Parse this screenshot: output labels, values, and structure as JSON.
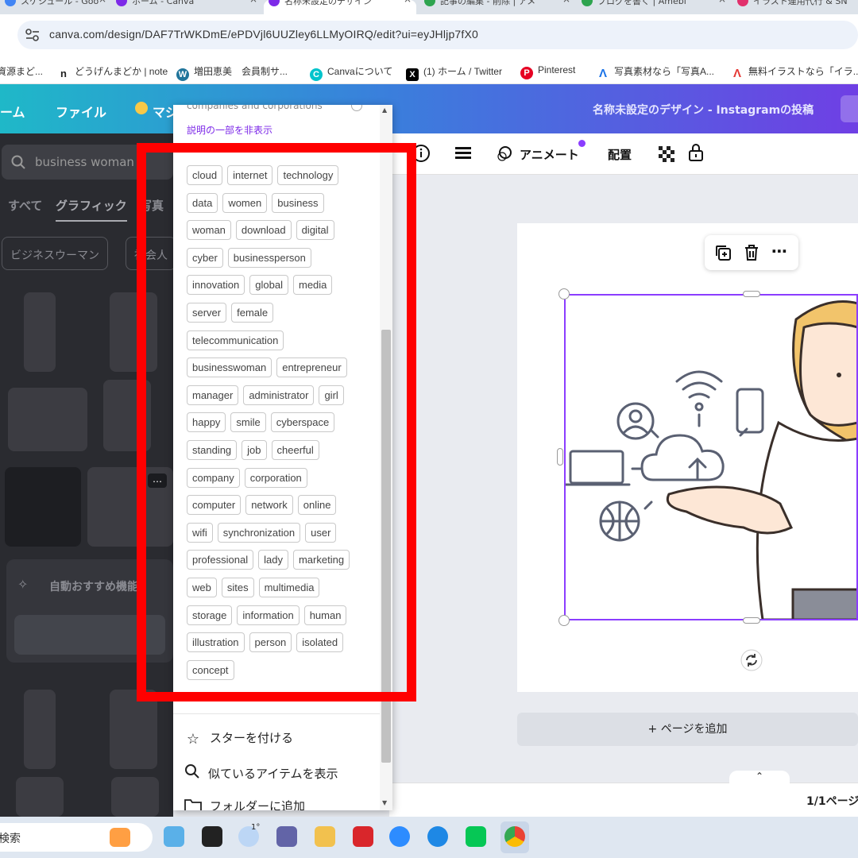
{
  "browser": {
    "tabs": [
      {
        "title": "スケジュール - Goo",
        "favicon_color": "#4285f4"
      },
      {
        "title": "ホーム - Canva",
        "favicon_color": "#7d2ae8"
      },
      {
        "title": "名称未設定のデザイン",
        "favicon_color": "#7d2ae8"
      },
      {
        "title": "記事の編集 - 削除 | アメ",
        "favicon_color": "#2ea44f"
      },
      {
        "title": "ブログを書く | Amebl",
        "favicon_color": "#2ea44f"
      },
      {
        "title": "イラスト運用代行 & SN",
        "favicon_color": "#e1306c"
      }
    ],
    "address": "canva.com/design/DAF7TrWKDmE/ePDVjl6UUZley6LLMyOIRQ/edit?ui=eyJHljp7fX0",
    "bookmarks": [
      {
        "label": "資源まど...",
        "icon": "doc-icon",
        "color": "#888"
      },
      {
        "label": "どうげんまどか | note",
        "icon": "n",
        "color": "#222"
      },
      {
        "label": "増田恵美　会員制サ...",
        "icon": "W",
        "color": "#21759b"
      },
      {
        "label": "Canvaについて",
        "icon": "C",
        "color": "#00c4cc"
      },
      {
        "label": "(1) ホーム / Twitter",
        "icon": "X",
        "color": "#000"
      },
      {
        "label": "Pinterest",
        "icon": "P",
        "color": "#e60023"
      },
      {
        "label": "写真素材なら「写真A...",
        "icon": "A",
        "color": "#1a73e8"
      },
      {
        "label": "無料イラストなら「イラ...",
        "icon": "A",
        "color": "#e53935"
      }
    ]
  },
  "canva_header": {
    "home": "ーム",
    "file": "ファイル",
    "magic": "マジ",
    "title": "名称未設定のデザイン - Instagramの投稿"
  },
  "side_panel": {
    "search_value": "business woman",
    "tabs": [
      "すべて",
      "グラフィック",
      "写真"
    ],
    "chips": [
      "ビジネスウーマン",
      "社会人"
    ],
    "auto_recommend": "自動おすすめ機能"
  },
  "toolbar": {
    "animate": "アニメート",
    "position": "配置"
  },
  "popup": {
    "top_text": "companies and corporations",
    "hide_description": "説明の一部を非表示",
    "tag_rows": [
      [
        "cloud",
        "internet",
        "technology"
      ],
      [
        "data",
        "women",
        "business"
      ],
      [
        "woman",
        "download",
        "digital"
      ],
      [
        "cyber",
        "businessperson"
      ],
      [
        "innovation",
        "global",
        "media"
      ],
      [
        "server",
        "female"
      ],
      [
        "telecommunication"
      ],
      [
        "businesswoman",
        "entrepreneur"
      ],
      [
        "manager",
        "administrator",
        "girl"
      ],
      [
        "happy",
        "smile",
        "cyberspace"
      ],
      [
        "standing",
        "job",
        "cheerful"
      ],
      [
        "company",
        "corporation"
      ],
      [
        "computer",
        "network",
        "online"
      ],
      [
        "wifi",
        "synchronization",
        "user"
      ],
      [
        "professional",
        "lady",
        "marketing"
      ],
      [
        "web",
        "sites",
        "multimedia"
      ],
      [
        "storage",
        "information",
        "human"
      ],
      [
        "illustration",
        "person",
        "isolated"
      ],
      [
        "concept"
      ]
    ],
    "menu": [
      {
        "label": "スターを付ける",
        "icon": "star-icon"
      },
      {
        "label": "似ているアイテムを表示",
        "icon": "search-icon"
      },
      {
        "label": "フォルダーに追加",
        "icon": "folder-icon"
      }
    ]
  },
  "canvas": {
    "add_page": "+ ページを追加",
    "page_count": "1/1ページ"
  },
  "taskbar": {
    "search_placeholder": "検索",
    "weather": "1°"
  },
  "colors": {
    "accent_purple": "#7d2ae8",
    "selection": "#8b3dff",
    "highlight_red": "#ff0000"
  }
}
